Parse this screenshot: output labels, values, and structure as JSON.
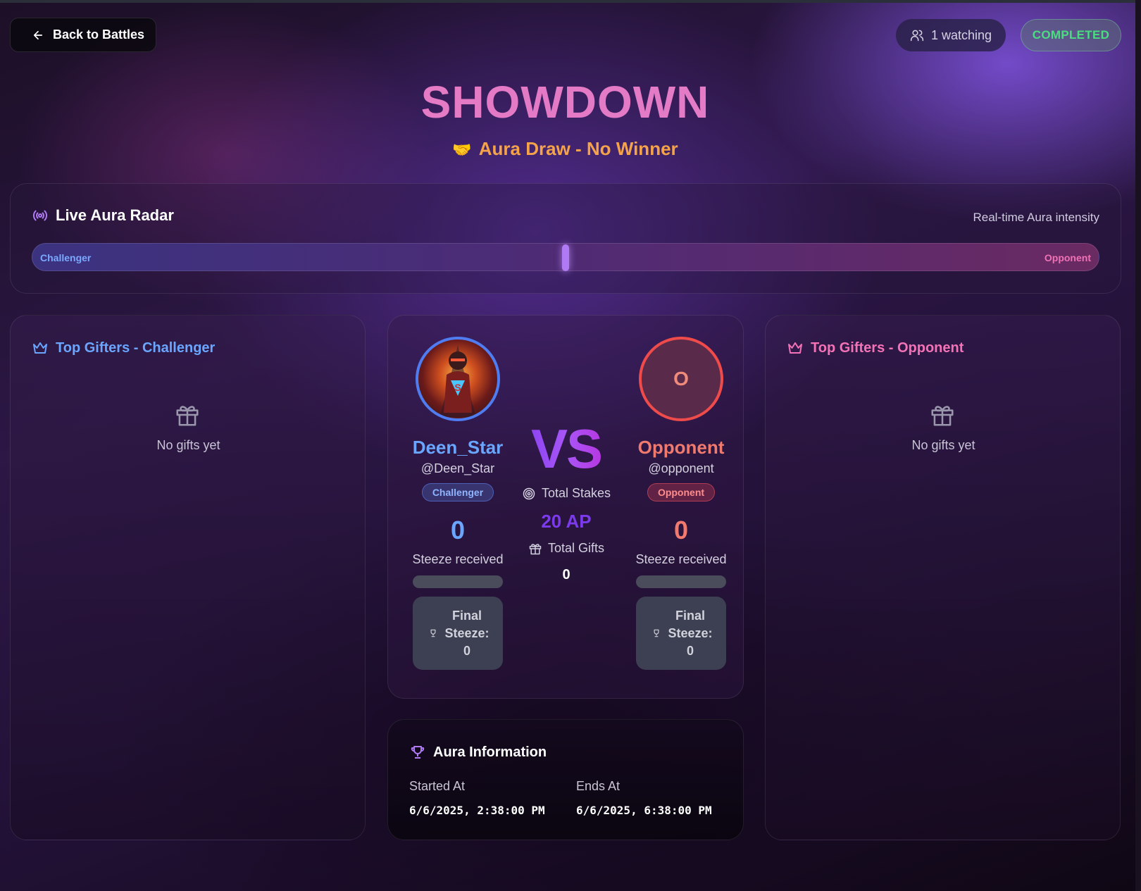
{
  "nav": {
    "back_label": "Back to Battles"
  },
  "header": {
    "watching": "1 watching",
    "status": "COMPLETED",
    "title": "SHOWDOWN",
    "result_emoji": "🤝",
    "result": "Aura Draw - No Winner"
  },
  "radar": {
    "title": "Live Aura Radar",
    "subtitle": "Real-time Aura intensity",
    "left_label": "Challenger",
    "right_label": "Opponent",
    "balance": 0.5
  },
  "gifters": {
    "left": {
      "title": "Top Gifters - Challenger",
      "empty": "No gifts yet"
    },
    "right": {
      "title": "Top Gifters - Opponent",
      "empty": "No gifts yet"
    }
  },
  "battle": {
    "challenger": {
      "name": "Deen_Star",
      "handle": "@Deen_Star",
      "role": "Challenger",
      "score": "0",
      "score_label": "Steeze received",
      "final": "Final Steeze: 0"
    },
    "opponent": {
      "initial": "O",
      "name": "Opponent",
      "handle": "@opponent",
      "role": "Opponent",
      "score": "0",
      "score_label": "Steeze received",
      "final": "Final Steeze: 0"
    },
    "vs": "VS",
    "stakes_label": "Total Stakes",
    "stakes_value": "20 AP",
    "gifts_label": "Total Gifts",
    "gifts_value": "0"
  },
  "info": {
    "title": "Aura Information",
    "started_label": "Started At",
    "started_value": "6/6/2025, 2:38:00 PM",
    "ends_label": "Ends At",
    "ends_value": "6/6/2025, 6:38:00 PM"
  },
  "colors": {
    "challenger": "#6aa6ff",
    "opponent": "#f07a6e",
    "accent": "#7c3aed",
    "title": "#e879c3",
    "result": "#f4a34a",
    "status": "#4ade80"
  }
}
